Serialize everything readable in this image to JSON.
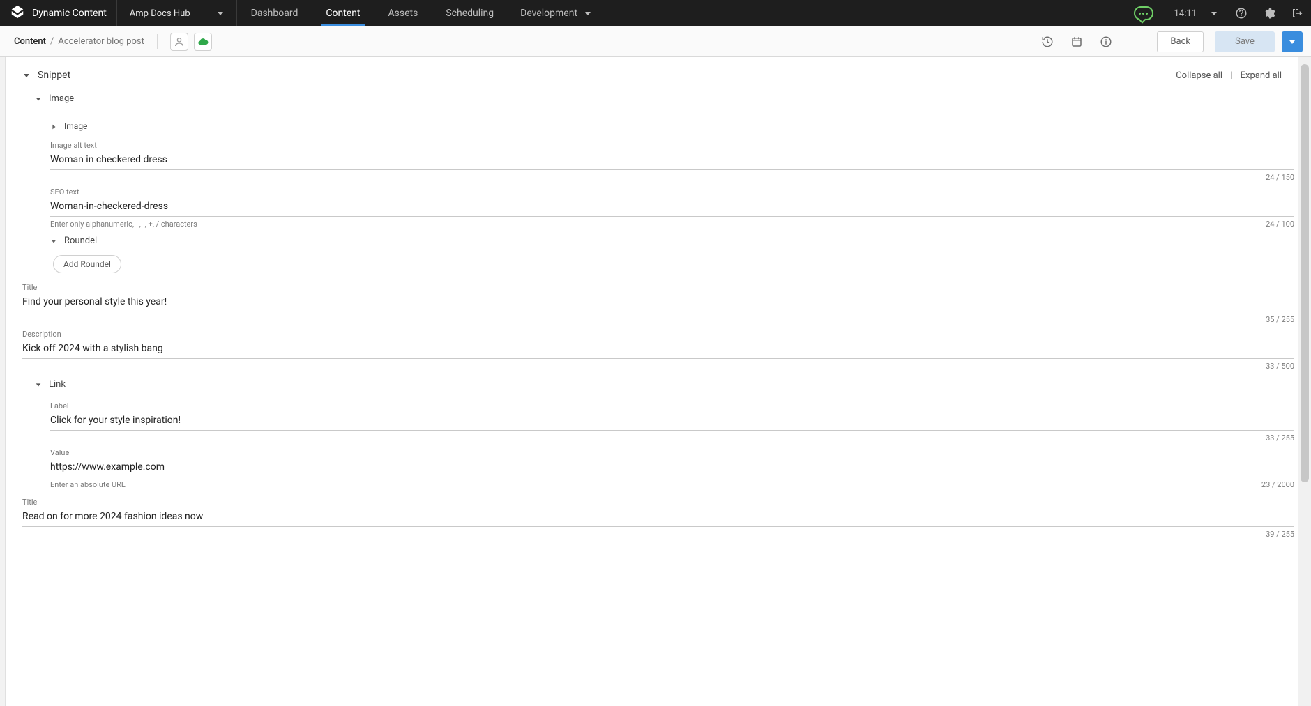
{
  "app_name": "Dynamic Content",
  "hub": {
    "name": "Amp Docs Hub"
  },
  "nav": {
    "items": [
      {
        "label": "Dashboard"
      },
      {
        "label": "Content"
      },
      {
        "label": "Assets"
      },
      {
        "label": "Scheduling"
      }
    ],
    "active_index": 1,
    "dropdown": {
      "label": "Development"
    }
  },
  "header": {
    "clock": "14:11"
  },
  "toolbar": {
    "breadcrumb": {
      "root": "Content",
      "sep": "/",
      "leaf": "Accelerator blog post"
    },
    "back_label": "Back",
    "save_label": "Save"
  },
  "controls": {
    "collapse_all": "Collapse all",
    "expand_all": "Expand all",
    "sep": "|"
  },
  "editor": {
    "snippet": {
      "label": "Snippet"
    },
    "image_section": {
      "label": "Image",
      "inner_image": {
        "label": "Image"
      },
      "alt_text": {
        "label": "Image alt text",
        "value": "Woman in checkered dress",
        "counter": "24 / 150"
      },
      "seo_text": {
        "label": "SEO text",
        "value": "Woman-in-checkered-dress",
        "helper": "Enter only alphanumeric, _, -, +, / characters",
        "counter": "24 / 100"
      },
      "roundel": {
        "label": "Roundel",
        "add_btn": "Add Roundel"
      }
    },
    "title_field": {
      "label": "Title",
      "value": "Find your personal style this year!",
      "counter": "35 / 255"
    },
    "description_field": {
      "label": "Description",
      "value": "Kick off 2024 with a stylish bang",
      "counter": "33 / 500"
    },
    "link_section": {
      "label": "Link",
      "label_field": {
        "label": "Label",
        "value": "Click for your style inspiration!",
        "counter": "33 / 255"
      },
      "value_field": {
        "label": "Value",
        "value": "https://www.example.com",
        "helper": "Enter an absolute URL",
        "counter": "23 / 2000"
      }
    },
    "bottom_title_field": {
      "label": "Title",
      "value": "Read on for more 2024 fashion ideas now",
      "counter": "39 / 255"
    }
  }
}
